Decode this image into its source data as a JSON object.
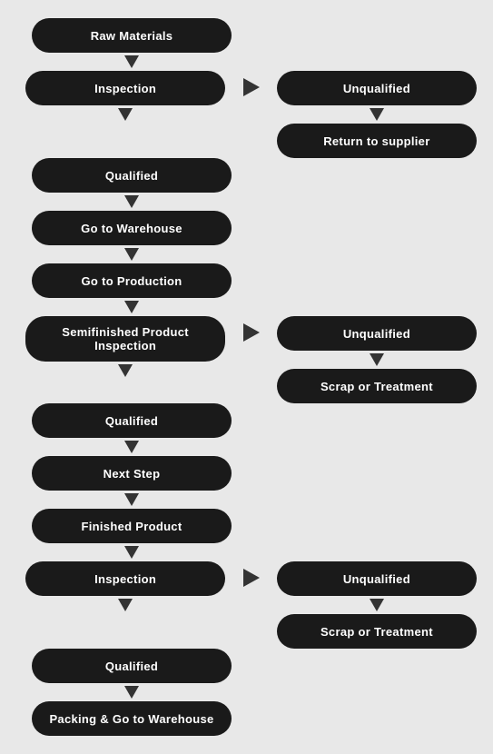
{
  "nodes": {
    "raw_materials": "Raw Materials",
    "inspection1": "Inspection",
    "qualified1": "Qualified",
    "go_to_warehouse": "Go to Warehouse",
    "go_to_production": "Go to Production",
    "semifinished_inspection": "Semifinished Product Inspection",
    "qualified2": "Qualified",
    "next_step": "Next Step",
    "finished_product": "Finished Product",
    "inspection2": "Inspection",
    "qualified3": "Qualified",
    "packing": "Packing & Go to Warehouse",
    "unqualified1": "Unqualified",
    "return_supplier": "Return to supplier",
    "unqualified2": "Unqualified",
    "scrap_treatment1": "Scrap or Treatment",
    "unqualified3": "Unqualified",
    "scrap_treatment2": "Scrap or Treatment"
  }
}
